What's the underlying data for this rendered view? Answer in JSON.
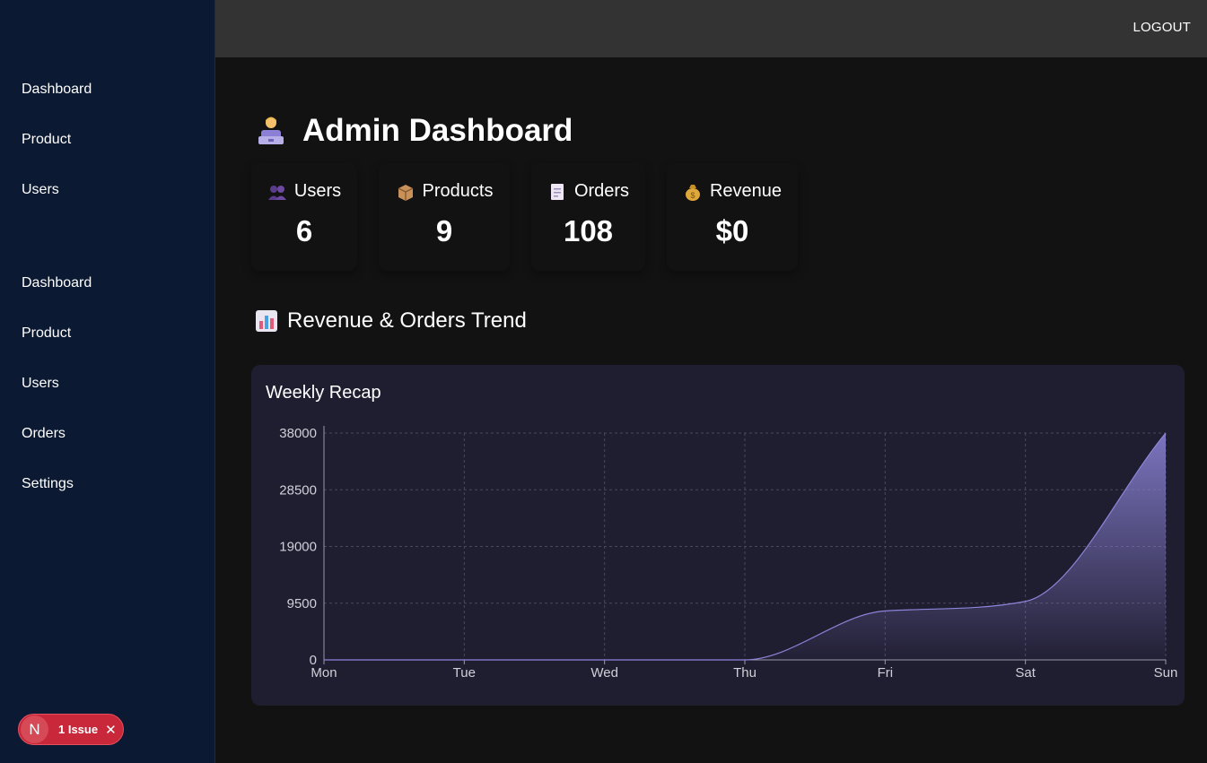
{
  "sidebar": {
    "nav_top": [
      "Dashboard",
      "Product",
      "Users"
    ],
    "nav_bottom": [
      "Dashboard",
      "Product",
      "Users",
      "Orders",
      "Settings"
    ]
  },
  "header": {
    "logout_label": "LOGOUT"
  },
  "page": {
    "title": "Admin Dashboard",
    "title_icon": "technologist-icon"
  },
  "stats": [
    {
      "label": "Users",
      "value": "6",
      "icon": "people-icon",
      "color": "#45a6f4"
    },
    {
      "label": "Products",
      "value": "9",
      "icon": "package-icon",
      "color": "#6cbf6e"
    },
    {
      "label": "Orders",
      "value": "108",
      "icon": "receipt-icon",
      "color": "#ffb855"
    },
    {
      "label": "Revenue",
      "value": "$0",
      "icon": "money-bag-icon",
      "color": "#ee5a5b"
    }
  ],
  "trend": {
    "title": "Revenue & Orders Trend",
    "icon": "bar-chart-icon"
  },
  "chart_data": {
    "type": "area",
    "title": "Weekly Recap",
    "categories": [
      "Mon",
      "Tue",
      "Wed",
      "Thu",
      "Fri",
      "Sat",
      "Sun"
    ],
    "values": [
      0,
      0,
      0,
      0,
      8200,
      9800,
      38000
    ],
    "yticks": [
      0,
      9500,
      19000,
      28500,
      38000
    ],
    "ylim": [
      0,
      38000
    ],
    "grid": true,
    "color": "#8c84d8"
  },
  "issue_badge": {
    "letter": "N",
    "label": "1 Issue"
  }
}
